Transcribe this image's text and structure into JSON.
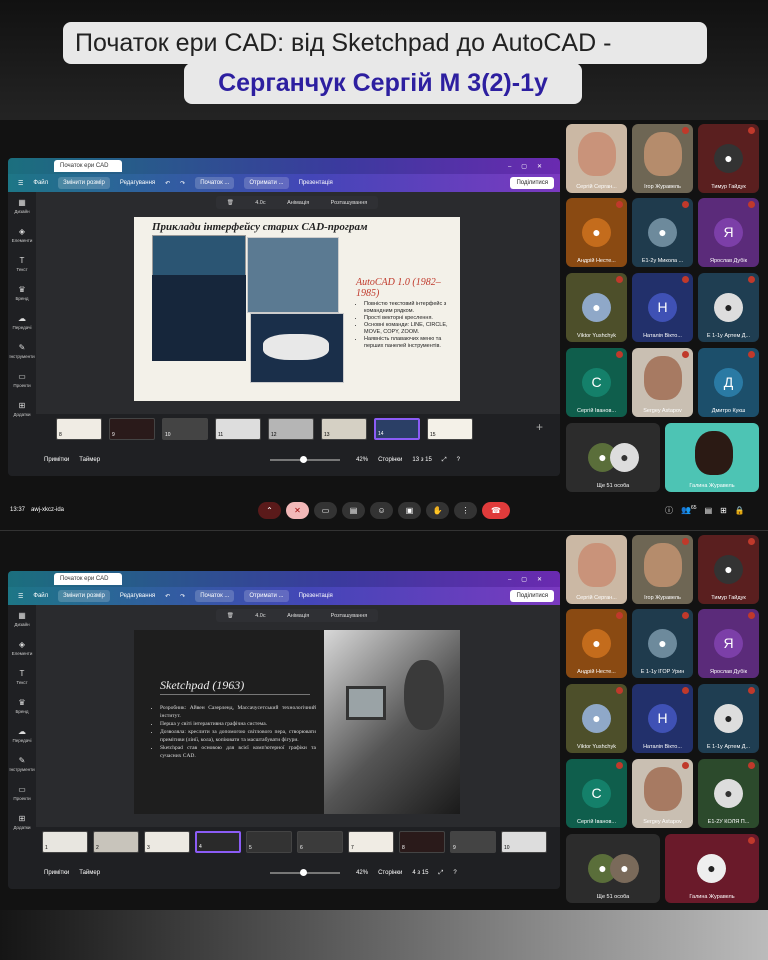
{
  "title_line1": "Початок ери CAD: від Sketchpad до AutoCAD -",
  "title_line2": "Серганчук Сергій М 3(2)-1у",
  "session1": {
    "tab_title": "Початок ери CAD",
    "menu": {
      "file": "Файл",
      "resize": "Змінити розмір",
      "edit": "Редагування",
      "doc": "Початок ...",
      "get": "Отримати ...",
      "present": "Презентація",
      "share": "Поділитися"
    },
    "slide_toolbar": {
      "time": "4.0с",
      "animation": "Анімація",
      "position": "Розташування"
    },
    "sidebar": [
      "Дизайн",
      "Елементи",
      "Текст",
      "Бренд",
      "Передачі",
      "Інструменти",
      "Проекти",
      "Додатки"
    ],
    "slide": {
      "title": "Приклади інтерфейсу старих CAD-програм",
      "subtitle": "AutoCAD 1.0 (1982–1985)",
      "bullets": [
        "Повністю текстовий інтерфейс з командним рядком.",
        "Прості векторні креслення.",
        "Основні команди: LINE, CIRCLE, MOVE, COPY, ZOOM.",
        "Наявність плаваючих меню та перших панелей інструментів."
      ]
    },
    "thumbs": [
      "8",
      "9",
      "10",
      "11",
      "12",
      "13",
      "14",
      "15"
    ],
    "bottom": {
      "notes": "Примітки",
      "timer": "Таймер",
      "zoom": "42%",
      "pages": "Сторінки",
      "page": "13 з 15"
    },
    "time": "13:37",
    "code": "awj-xkcz-ida",
    "count": "65",
    "participants": [
      "Сергій Серган...",
      "Ігор Журавель",
      "Тимур Гайдук",
      "Андрій Несте...",
      "Е1-2у Микола ...",
      "Ярослав Дубік",
      "Viktor Yushchyk",
      "Наталія Вікто...",
      "Е 1-1у Артем Д...",
      "Сергій Іванов...",
      "Sergey Astapov",
      "Дмитро Кукш",
      "Ще 51 особа",
      "Галина Журавель"
    ]
  },
  "session2": {
    "tab_title": "Початок ери CAD",
    "slide": {
      "title": "Sketchpad (1963)",
      "bullets": [
        "Розробник: Айвен Сазерленд, Массачусетський технологічний інститут.",
        "Перша у світі інтерактивна графічна система.",
        "Дозволяла: креслити за допомогою світлового пера, створювати примітиви (лінії, кола), копіювати та масштабувати фігури.",
        "Sketchpad став основою для всієї комп'ютерної графіки та сучасних CAD."
      ]
    },
    "thumbs": [
      "1",
      "2",
      "3",
      "4",
      "5",
      "6",
      "7",
      "8",
      "9",
      "10"
    ],
    "bottom": {
      "notes": "Примітки",
      "timer": "Таймер",
      "zoom": "42%",
      "pages": "Сторінки",
      "page": "4 з 15"
    },
    "participants": [
      "Сергій Серган...",
      "Ігор Журавель",
      "Тимур Гайдук",
      "Андрій Несте...",
      "Е 1-1у ІГОР Урин",
      "Ярослав Дубік",
      "Viktor Yushchyk",
      "Наталія Вікто...",
      "Е 1-1у Артем Д...",
      "Сергій Іванов...",
      "Sergey Astapov",
      "Е1-2У КОЛЯ П...",
      "Ще 51 особа",
      "Галина Журавель"
    ]
  },
  "colors": {
    "title_blue": "#2d1fa0",
    "end_call": "#e03b3b",
    "canva_teal": "#1d7686",
    "canva_purple": "#7b3ac0",
    "slide_red": "#c0392b"
  }
}
